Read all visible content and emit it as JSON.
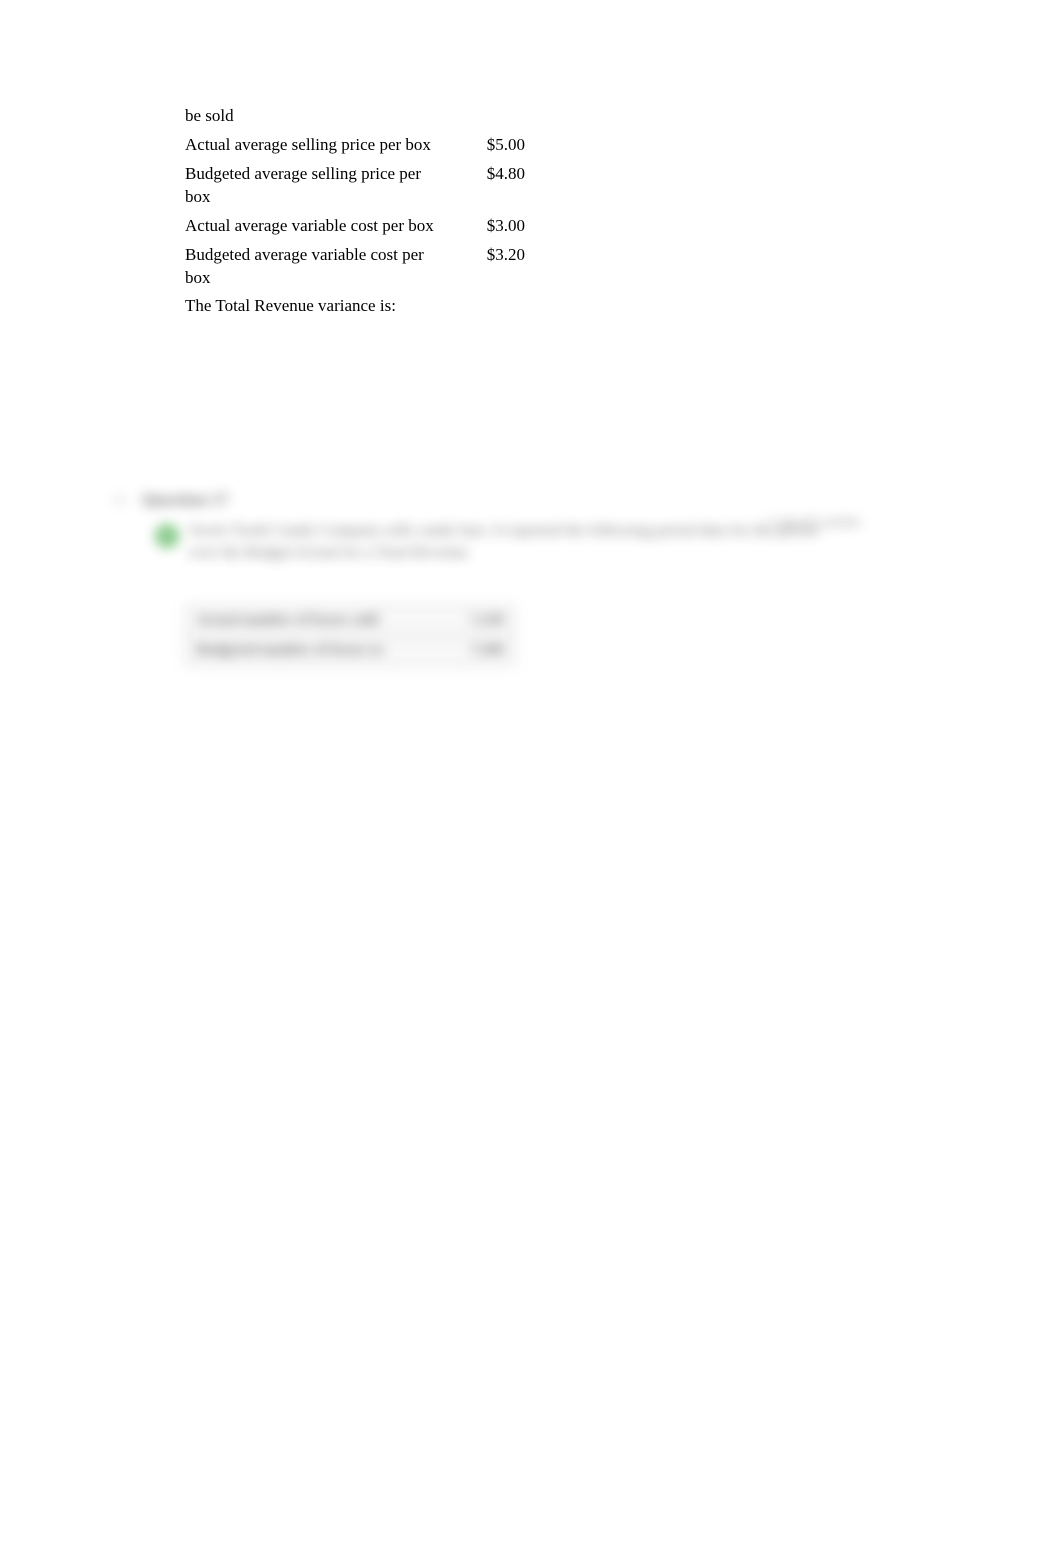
{
  "top_table": {
    "rows": [
      {
        "label": "be sold",
        "value": ""
      },
      {
        "label": "Actual average selling price per box",
        "value": "$5.00"
      },
      {
        "label": "Budgeted average selling price per box",
        "value": "$4.80"
      },
      {
        "label": "Actual average variable cost per box",
        "value": "$3.00"
      },
      {
        "label": "Budgeted average variable cost per box",
        "value": "$3.20"
      }
    ],
    "question_text": "The Total Revenue variance is:"
  },
  "blurred": {
    "question_label": "Question 17",
    "points": "1 out of 1 points",
    "body_text": "Sweet Tooth Candy Company sells candy bars. It reported the following period data for the period over the Budget/Actual for a Total Revenue",
    "table": [
      {
        "label": "Actual number of boxes sold",
        "value": "7,250"
      },
      {
        "label": "Budgeted number of boxes to",
        "value": "7,500"
      }
    ]
  }
}
